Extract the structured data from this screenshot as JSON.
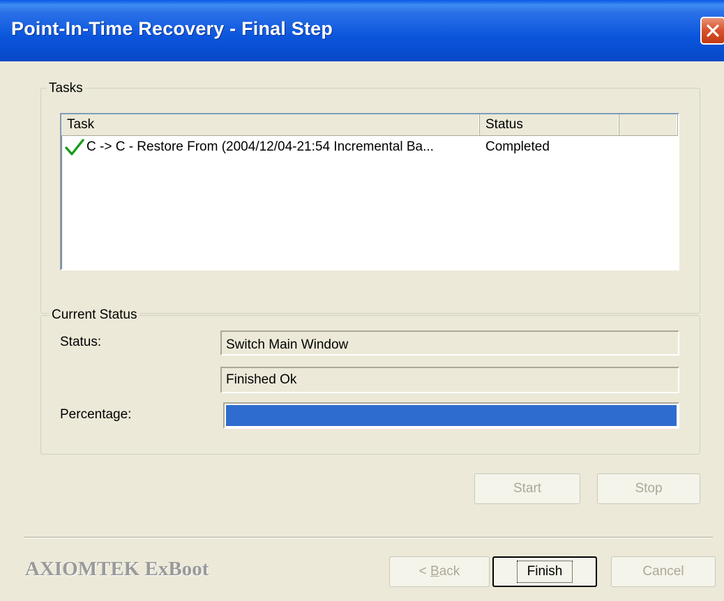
{
  "window": {
    "title": "Point-In-Time Recovery - Final Step",
    "close_icon": "close-icon"
  },
  "tasks_group": {
    "legend": "Tasks",
    "columns": [
      "Task",
      "Status",
      ""
    ],
    "rows": [
      {
        "icon": "checkmark-icon",
        "task": "C -> C - Restore From (2004/12/04-21:54 Incremental Ba...",
        "status": "Completed"
      }
    ]
  },
  "status_group": {
    "legend": "Current Status",
    "status_label": "Status:",
    "status_value": "Switch Main Window",
    "status_value_2": "Finished Ok",
    "percentage_label": "Percentage:",
    "progress_fraction": 1.0,
    "progress_color": "#2f6ccf"
  },
  "buttons": {
    "start": "Start",
    "stop": "Stop",
    "back_prefix": "< ",
    "back_mnemonic": "B",
    "back_rest": "ack",
    "finish": "Finish",
    "cancel": "Cancel"
  },
  "footer": {
    "brand": "AXIOMTEK ExBoot"
  }
}
